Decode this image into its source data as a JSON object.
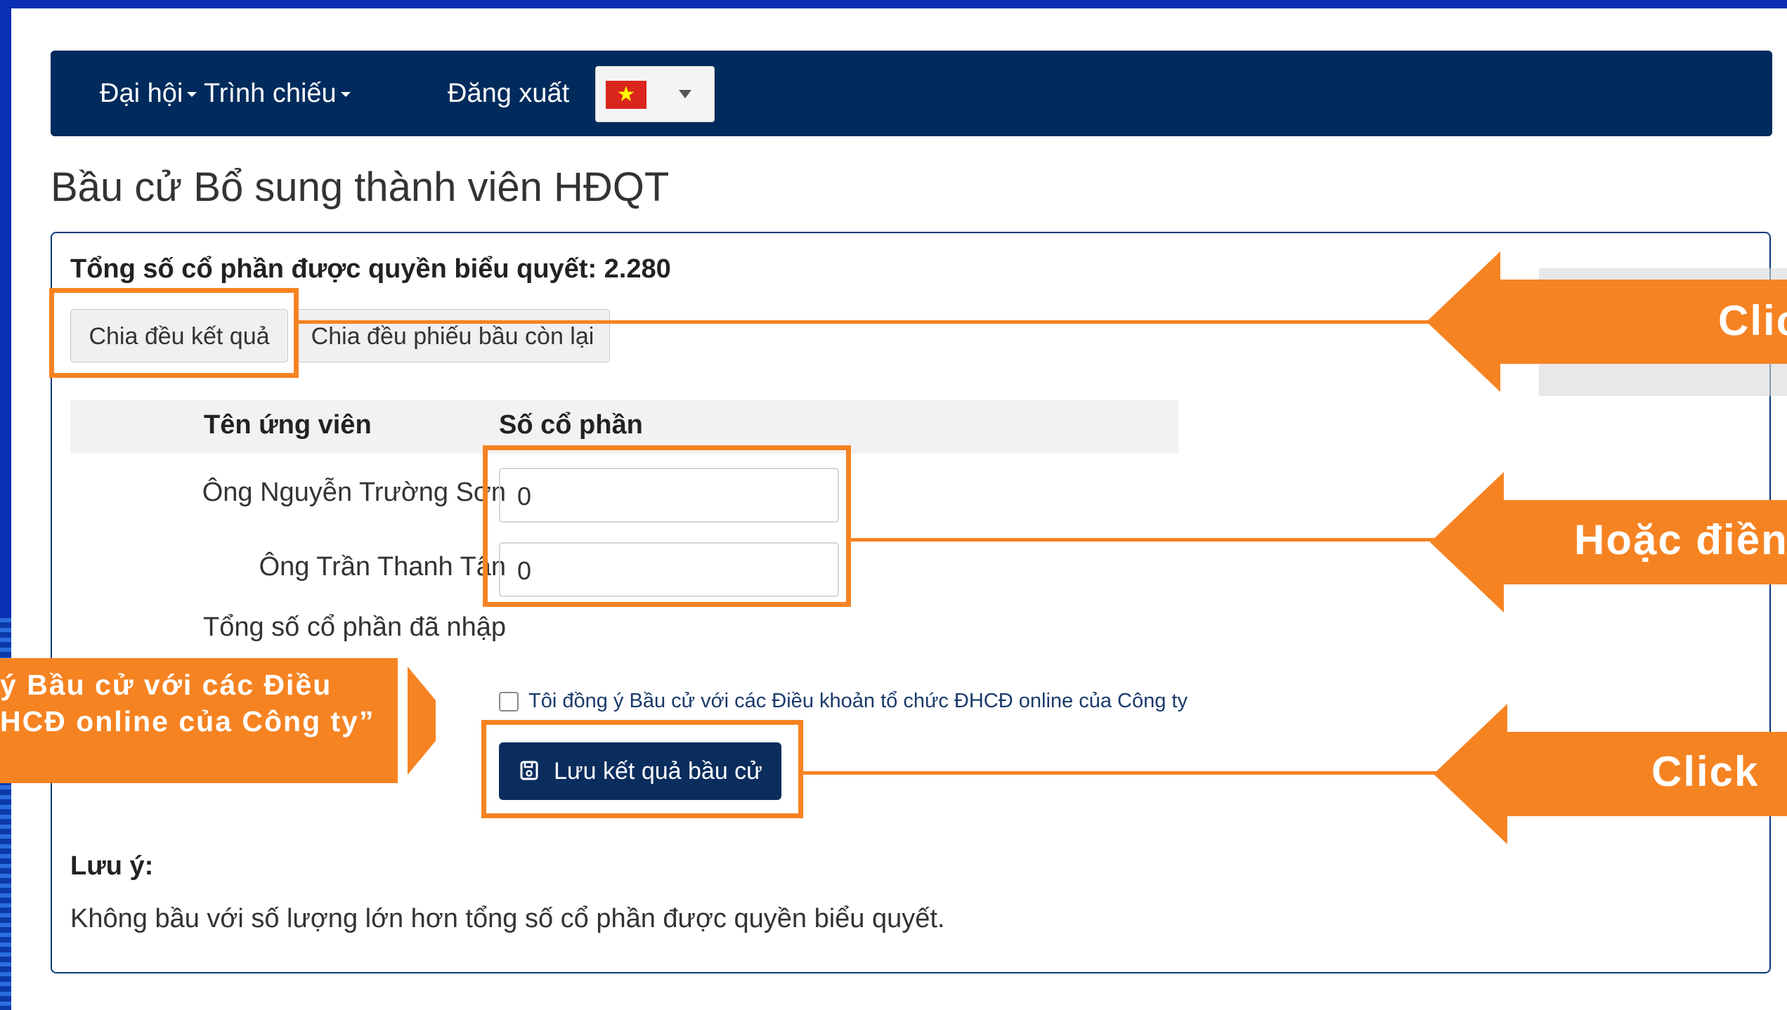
{
  "navbar": {
    "menu_dai_hoi": "Đại hội",
    "menu_trinh_chieu": "Trình chiếu",
    "logout": "Đăng xuất"
  },
  "page": {
    "title": "Bầu cử Bổ sung thành viên HĐQT"
  },
  "panel": {
    "total_votes": "Tổng số cổ phần được quyền biểu quyết: 2.280",
    "btn_split_result": "Chia đều kết quả",
    "btn_split_remaining": "Chia đều phiếu bầu còn lại",
    "table": {
      "col_name": "Tên ứng viên",
      "col_shares": "Số cổ phần",
      "rows": [
        {
          "name": "Ông Nguyễn Trường Sơn",
          "value": "0"
        },
        {
          "name": "Ông Trần Thanh Tân",
          "value": "0"
        }
      ]
    },
    "total_entered_label": "Tổng số cổ phần đã nhập",
    "agree_label": "Tôi đồng ý Bầu cử với các Điều khoản tổ chức ĐHCĐ online của Công ty",
    "btn_save": "Lưu kết quả bầu cử",
    "note_title": "Lưu ý:",
    "note_text": "Không bầu với số lượng lớn hơn tổng số cổ phần được quyền biểu quyết."
  },
  "annotations": {
    "arrow_1": "Clic",
    "arrow_2": "Hoặc điền",
    "arrow_3": "Click",
    "left_note_line1": "ý Bầu cử với các Điều",
    "left_note_line2": "HCĐ online của Công ty”"
  },
  "colors": {
    "navbar": "#002b5c",
    "accent_orange": "#f68322",
    "save_button": "#0b2d5e"
  }
}
